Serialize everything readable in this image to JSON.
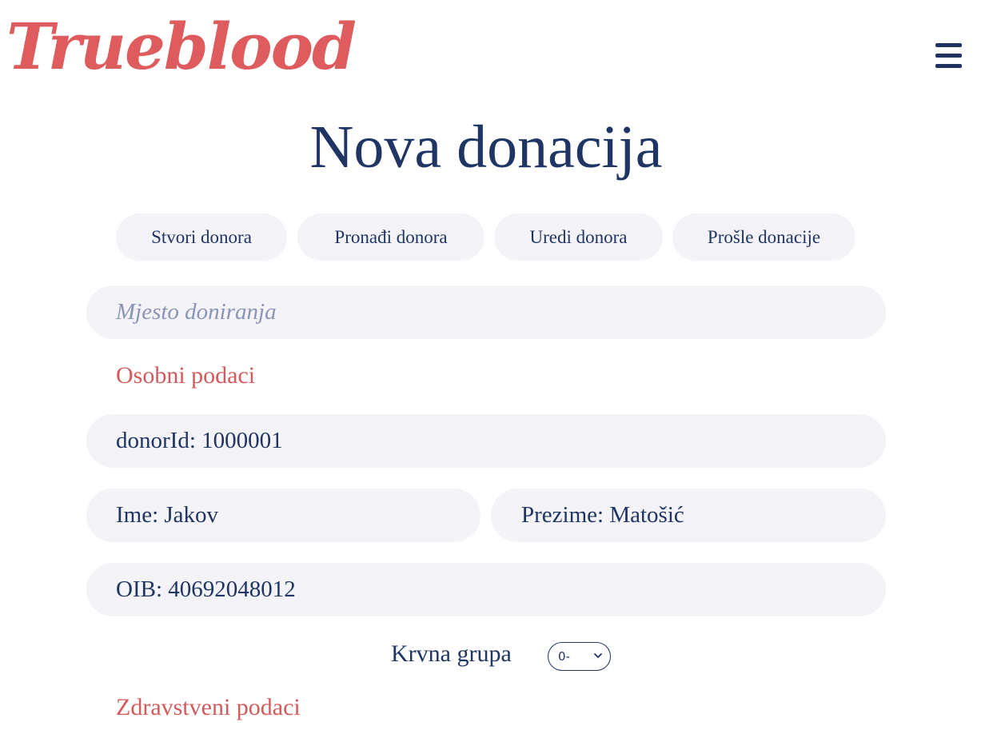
{
  "header": {
    "logo_text": "Trueblood",
    "menu_icon": "hamburger-menu-icon"
  },
  "page_title": "Nova donacija",
  "tabs": [
    {
      "label": "Stvori donora"
    },
    {
      "label": "Pronađi donora"
    },
    {
      "label": "Uredi donora"
    },
    {
      "label": "Prošle donacije"
    }
  ],
  "form": {
    "location_placeholder": "Mjesto doniranja",
    "personal_section": "Osobni podaci",
    "donor_id": "donorId: 1000001",
    "first_name": "Ime: Jakov",
    "last_name": "Prezime: Matošić",
    "oib": "OIB: 40692048012",
    "blood_group_label": "Krvna grupa",
    "blood_group_value": "0-",
    "health_section": "Zdravstveni podaci"
  },
  "colors": {
    "brand": "#de5c5e",
    "navy": "#1f3564",
    "field_bg": "#f3f3f8"
  }
}
